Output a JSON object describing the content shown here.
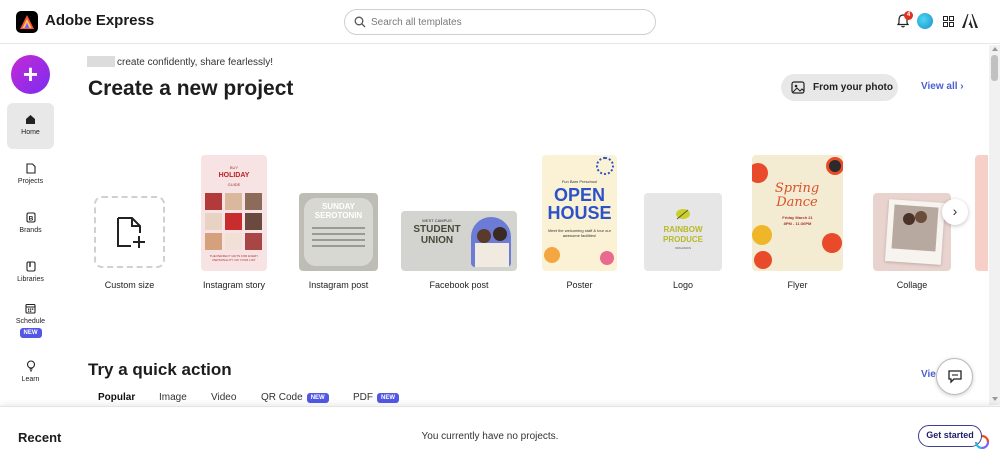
{
  "app": {
    "title": "Adobe Express"
  },
  "search": {
    "placeholder": "Search all templates"
  },
  "header": {
    "notification_count": "4"
  },
  "sidebar": {
    "create_label": "+",
    "items": [
      {
        "label": "Home"
      },
      {
        "label": "Projects"
      },
      {
        "label": "Brands"
      },
      {
        "label": "Libraries"
      },
      {
        "label": "Schedule",
        "badge": "NEW"
      },
      {
        "label": "Learn"
      }
    ]
  },
  "main": {
    "tagline": "create confidently, share fearlessly!",
    "title": "Create a new project",
    "from_photo_label": "From your photo",
    "view_all_label": "View all",
    "cards": [
      {
        "label": "Custom size"
      },
      {
        "label": "Instagram story",
        "thumb_text": [
          "BUY",
          "HOLIDAY",
          "GUIDE",
          "THE PERFECT GIFTS FOR EVERY PERSONALITY ON YOUR LIST"
        ]
      },
      {
        "label": "Instagram post",
        "thumb_text": [
          "SUNDAY",
          "SEROTONIN"
        ]
      },
      {
        "label": "Facebook post",
        "thumb_text": [
          "WEST CAMPUS",
          "STUDENT",
          "UNION"
        ]
      },
      {
        "label": "Poster",
        "thumb_text": [
          "Fun Barn Preschool",
          "OPEN",
          "HOUSE",
          "Meet the welcoming staff & tour our awesome facilities!"
        ]
      },
      {
        "label": "Logo",
        "thumb_text": [
          "RAINBOW",
          "PRODUCE",
          "ORGANICS"
        ]
      },
      {
        "label": "Flyer",
        "thumb_text": [
          "Spring",
          "Dance",
          "Friday March 21",
          "8PM - 11:30PM"
        ]
      },
      {
        "label": "Collage"
      }
    ],
    "quick_action": {
      "title": "Try a quick action",
      "tabs": [
        {
          "label": "Popular",
          "badge": ""
        },
        {
          "label": "Image",
          "badge": ""
        },
        {
          "label": "Video",
          "badge": ""
        },
        {
          "label": "QR Code",
          "badge": "NEW"
        },
        {
          "label": "PDF",
          "badge": "NEW"
        }
      ],
      "view_all_partial": "Vie"
    }
  },
  "recent": {
    "title": "Recent",
    "empty_message": "You currently have no projects.",
    "get_started_label": "Get started"
  },
  "colors": {
    "accent": "#4b5fcf",
    "create_gradient_start": "#c52ad6",
    "create_gradient_end": "#7a2cf0",
    "badge": "#5258e4"
  }
}
